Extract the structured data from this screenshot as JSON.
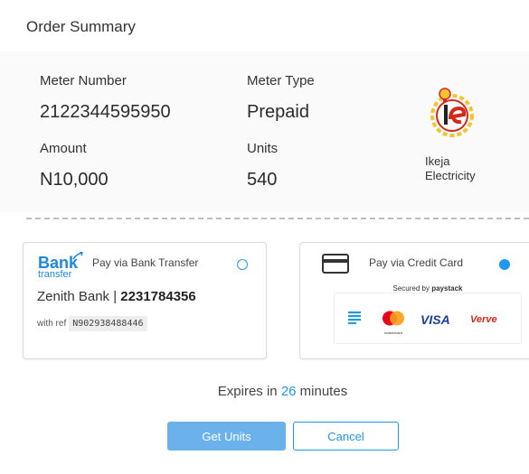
{
  "page_title": "Order Summary",
  "summary": {
    "meter_number_label": "Meter Number",
    "meter_number": "2122344595950",
    "meter_type_label": "Meter Type",
    "meter_type": "Prepaid",
    "amount_label": "Amount",
    "amount": "N10,000",
    "units_label": "Units",
    "units": "540",
    "provider_name_line1": "Ikeja",
    "provider_name_line2": "Electricity"
  },
  "bank_transfer": {
    "logo_line1": "Bank",
    "logo_line2": "transfer",
    "title": "Pay via Bank Transfer",
    "bank_name": "Zenith Bank",
    "separator": "|",
    "account_number": "2231784356",
    "ref_label": "with ref",
    "ref_value": "N902938488446",
    "selected": false
  },
  "credit_card": {
    "title": "Pay via Credit Card",
    "secured_by": "Secured by",
    "secured_brand": "paystack",
    "mastercard_label": "mastercard",
    "visa_label": "VISA",
    "verve_label": "Verve",
    "selected": true
  },
  "expiry": {
    "prefix": "Expires in",
    "minutes": "26",
    "suffix": "minutes"
  },
  "actions": {
    "primary_label": "Get Units",
    "cancel_label": "Cancel"
  },
  "colors": {
    "accent": "#2196f3",
    "primary_button": "#6bb2ec",
    "cancel_border": "#2196f3",
    "ikeja_red": "#d42a1c",
    "ikeja_yellow": "#f4c430",
    "verve_red": "#d42a1c",
    "visa_blue": "#1a3fa0"
  }
}
